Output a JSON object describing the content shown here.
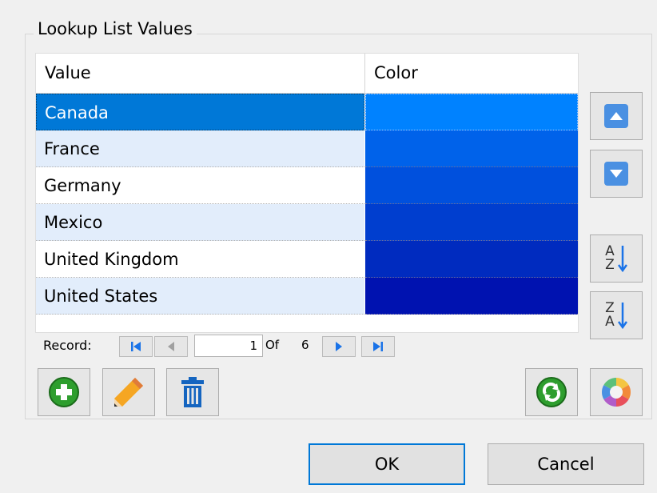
{
  "group": {
    "title": "Lookup List Values"
  },
  "grid": {
    "columns": [
      "Value",
      "Color"
    ],
    "rows": [
      {
        "value": "Canada",
        "color": "#0082ff"
      },
      {
        "value": "France",
        "color": "#0062ea"
      },
      {
        "value": "Germany",
        "color": "#0050dd"
      },
      {
        "value": "Mexico",
        "color": "#003ecf"
      },
      {
        "value": "United Kingdom",
        "color": "#002bbf"
      },
      {
        "value": "United States",
        "color": "#0012b0"
      }
    ],
    "selected_row": 0
  },
  "navigator": {
    "label": "Record:",
    "current": "1",
    "of_label": "Of",
    "total": "6"
  },
  "side_buttons": {
    "move_up": "arrow-up-icon",
    "move_down": "arrow-down-icon",
    "sort_az": {
      "top": "A",
      "bottom": "Z"
    },
    "sort_za": {
      "top": "Z",
      "bottom": "A"
    }
  },
  "toolbar": {
    "add": "plus-circle-icon",
    "edit": "pencil-icon",
    "delete": "trash-icon",
    "refresh": "refresh-icon",
    "color": "color-wheel-icon"
  },
  "dialog": {
    "ok_label": "OK",
    "cancel_label": "Cancel"
  },
  "colors": {
    "selection": "#0078d7",
    "alt_row": "#e2edfb",
    "accent": "#4a90e2"
  }
}
